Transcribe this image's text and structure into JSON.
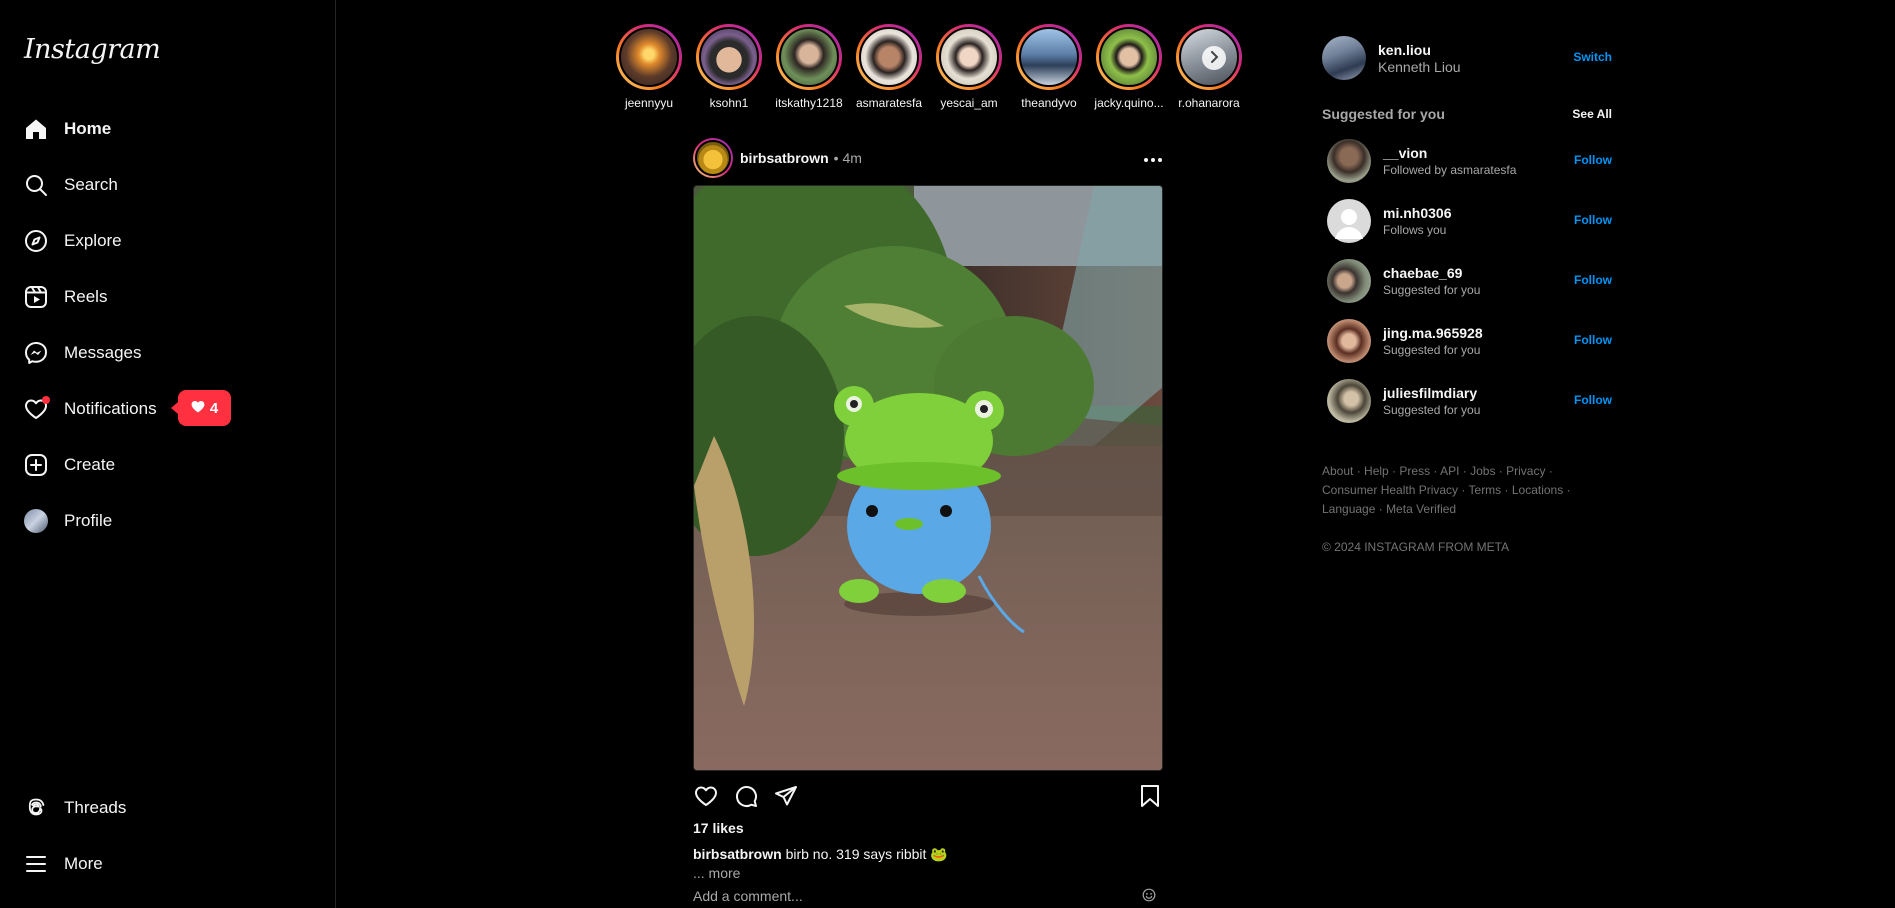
{
  "app": {
    "logo": "Instagram"
  },
  "sidebar": {
    "items": [
      {
        "label": "Home",
        "icon": "home-icon"
      },
      {
        "label": "Search",
        "icon": "search-icon"
      },
      {
        "label": "Explore",
        "icon": "compass-icon"
      },
      {
        "label": "Reels",
        "icon": "reels-icon"
      },
      {
        "label": "Messages",
        "icon": "messenger-icon"
      },
      {
        "label": "Notifications",
        "icon": "heart-icon"
      },
      {
        "label": "Create",
        "icon": "plus-square-icon"
      },
      {
        "label": "Profile",
        "icon": "avatar"
      }
    ],
    "bottom": [
      {
        "label": "Threads",
        "icon": "threads-icon"
      },
      {
        "label": "More",
        "icon": "menu-icon"
      }
    ],
    "notification_count": "4"
  },
  "stories": [
    {
      "name": "jeennyyu"
    },
    {
      "name": "ksohn1"
    },
    {
      "name": "itskathy1218"
    },
    {
      "name": "asmaratesfa"
    },
    {
      "name": "yescai_am"
    },
    {
      "name": "theandyvo"
    },
    {
      "name": "jacky.quino..."
    },
    {
      "name": "r.ohanarora"
    }
  ],
  "post": {
    "username": "birbsatbrown",
    "time": "• 4m",
    "likes": "17 likes",
    "caption_user": "birbsatbrown",
    "caption_text": "birb no. 319 says ribbit 🐸",
    "more": "... more",
    "comment_placeholder": "Add a comment..."
  },
  "account": {
    "username": "ken.liou",
    "name": "Kenneth Liou",
    "switch_label": "Switch"
  },
  "suggestions": {
    "title": "Suggested for you",
    "see_all": "See All",
    "follow_label": "Follow",
    "items": [
      {
        "username": "__vion",
        "subtitle": "Followed by asmaratesfa"
      },
      {
        "username": "mi.nh0306",
        "subtitle": "Follows you"
      },
      {
        "username": "chaebae_69",
        "subtitle": "Suggested for you"
      },
      {
        "username": "jing.ma.965928",
        "subtitle": "Suggested for you"
      },
      {
        "username": "juliesfilmdiary",
        "subtitle": "Suggested for you"
      }
    ]
  },
  "footer": {
    "links": [
      "About",
      "Help",
      "Press",
      "API",
      "Jobs",
      "Privacy",
      "Consumer Health Privacy",
      "Terms",
      "Locations",
      "Language",
      "Meta Verified"
    ],
    "copyright": "© 2024 INSTAGRAM FROM META"
  },
  "colors": {
    "accent": "#0095f6",
    "notification": "#ff3040",
    "background": "#000000"
  }
}
